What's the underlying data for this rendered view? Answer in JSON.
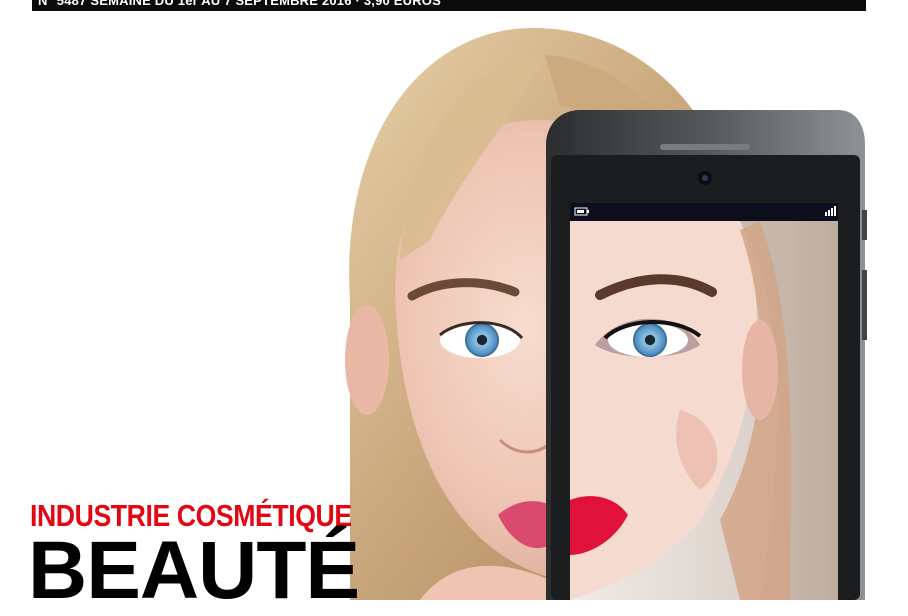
{
  "header": {
    "issue_line": "N° 5487 SEMAINE DU 1er AU 7 SEPTEMBRE 2016 · 3,90 EUROS"
  },
  "cover": {
    "kicker": "INDUSTRIE COSMÉTIQUE",
    "headline": "BEAUTÉ"
  },
  "colors": {
    "kicker_red": "#e30613",
    "bar_black": "#0b0b0b",
    "lip_left": "#d84a6e",
    "lip_right": "#e0123c"
  },
  "icons": [
    "battery-icon",
    "signal-icon",
    "camera-icon"
  ]
}
